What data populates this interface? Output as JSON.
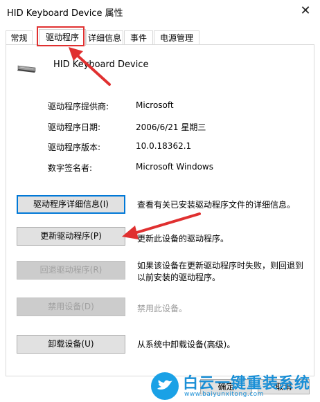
{
  "window": {
    "title": "HID Keyboard Device 属性"
  },
  "tabs": [
    {
      "label": "常规"
    },
    {
      "label": "驱动程序"
    },
    {
      "label": "详细信息"
    },
    {
      "label": "事件"
    },
    {
      "label": "电源管理"
    }
  ],
  "device": {
    "name": "HID Keyboard Device",
    "icon": "keyboard-icon"
  },
  "info": [
    {
      "label": "驱动程序提供商:",
      "value": "Microsoft"
    },
    {
      "label": "驱动程序日期:",
      "value": "2006/6/21 星期三"
    },
    {
      "label": "驱动程序版本:",
      "value": "10.0.18362.1"
    },
    {
      "label": "数字签名者:",
      "value": "Microsoft Windows"
    }
  ],
  "actions": [
    {
      "button": "驱动程序详细信息(I)",
      "desc": "查看有关已安装驱动程序文件的详细信息。",
      "enabled": true
    },
    {
      "button": "更新驱动程序(P)",
      "desc": "更新此设备的驱动程序。",
      "enabled": true
    },
    {
      "button": "回退驱动程序(R)",
      "desc": "如果该设备在更新驱动程序时失败，则回退到以前安装的驱动程序。",
      "enabled": false
    },
    {
      "button": "禁用设备(D)",
      "desc": "禁用此设备。",
      "enabled": false
    },
    {
      "button": "卸载设备(U)",
      "desc": "从系统中卸载设备(高级)。",
      "enabled": true
    }
  ],
  "footer": {
    "ok": "确定",
    "cancel": "取消"
  },
  "watermark": {
    "title": "白云一键重装系统",
    "url": "www.baiyunxitong.com"
  },
  "colors": {
    "annotation": "#e03030",
    "focus": "#0078d7",
    "watermark": "#1a8fd6"
  }
}
